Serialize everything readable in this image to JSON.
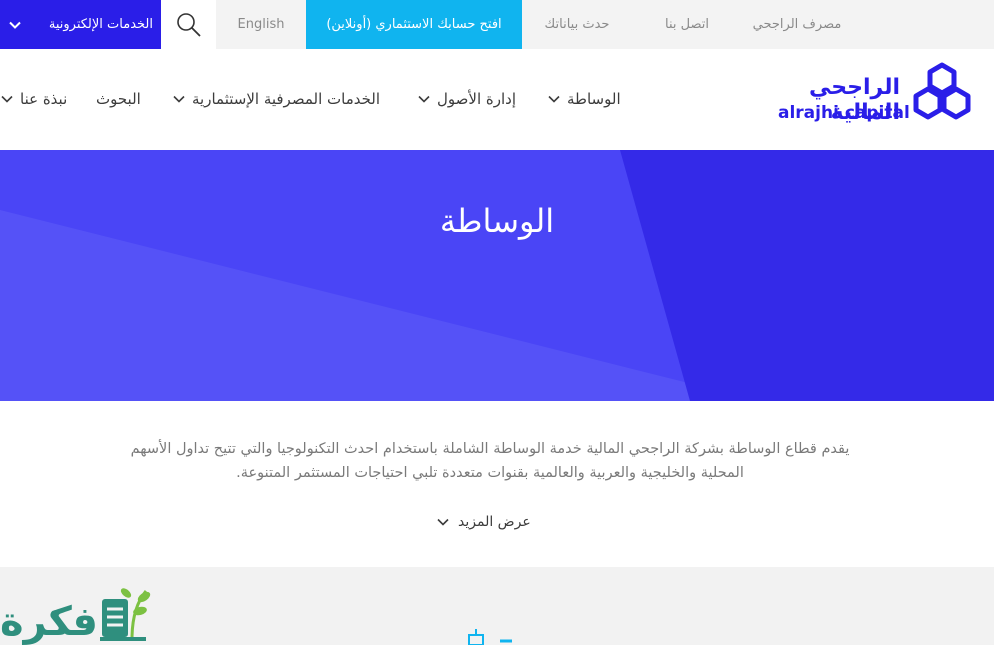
{
  "topbar": {
    "eservices_label": "الخدمات الإلكترونية",
    "english_label": "English",
    "open_account_label": "افتح حسابك الاستثماري (أونلاين)",
    "update_data_label": "حدث بياناتك",
    "contact_label": "اتصل بنا",
    "bank_label": "مصرف الراجحي"
  },
  "nav": {
    "about_label": "نبذة عنا",
    "research_label": "البحوث",
    "banking_label": "الخدمات المصرفية الإستثمارية",
    "asset_label": "إدارة الأصول",
    "brokerage_label": "الوساطة"
  },
  "logo": {
    "arabic": "الراجحي المالية",
    "english": "alrajhi capital"
  },
  "hero": {
    "title": "الوساطة"
  },
  "intro": {
    "text": "يقدم قطاع الوساطة بشركة الراجحي المالية خدمة الوساطة الشاملة باستخدام احدث التكنولوجيا والتي تتيح تداول الأسهم المحلية والخليجية والعربية والعالمية بقنوات متعددة تلبي احتياجات المستثمر المتنوعة.",
    "more_label": "عرض المزيد"
  },
  "watermark": {
    "text": "فكرة"
  },
  "colors": {
    "brand_blue": "#2a1ee8",
    "cyan": "#10b4ef",
    "hero_blue": "#3b32f0",
    "text_gray": "#7a7a7a"
  },
  "icons": [
    "search-icon",
    "chevron-down-icon",
    "alrajhi-logo-mark"
  ]
}
